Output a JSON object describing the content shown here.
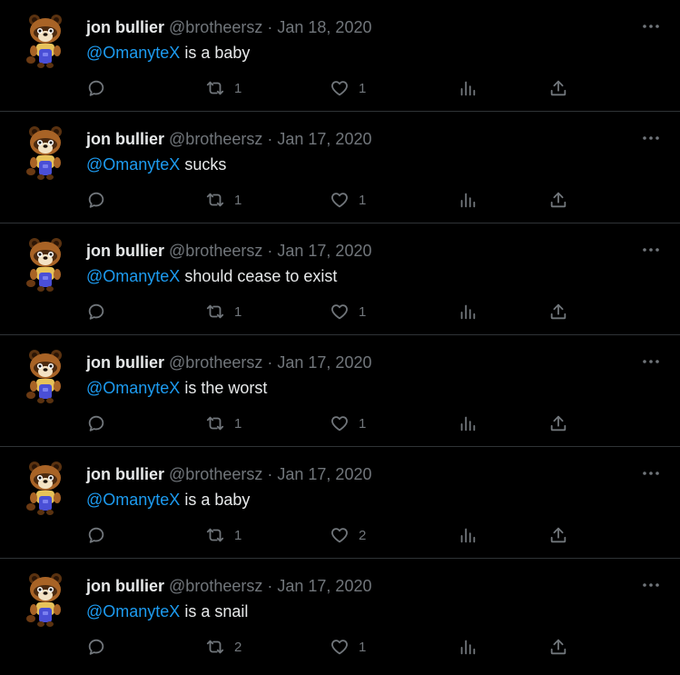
{
  "colors": {
    "background": "#000000",
    "text_primary": "#e7e9ea",
    "text_secondary": "#71767b",
    "mention": "#1d9bf0",
    "divider": "#2f3336"
  },
  "icons": {
    "reply": "reply-icon",
    "retweet": "retweet-icon",
    "like": "heart-icon",
    "views": "views-icon",
    "share": "share-icon",
    "more": "more-icon"
  },
  "tweets": [
    {
      "author_name": "jon bullier",
      "handle": "@brotheersz",
      "separator": "·",
      "date": "Jan 18, 2020",
      "mention": "@OmanyteX",
      "text": " is a baby",
      "retweets": "1",
      "likes": "1"
    },
    {
      "author_name": "jon bullier",
      "handle": "@brotheersz",
      "separator": "·",
      "date": "Jan 17, 2020",
      "mention": "@OmanyteX",
      "text": " sucks",
      "retweets": "1",
      "likes": "1"
    },
    {
      "author_name": "jon bullier",
      "handle": "@brotheersz",
      "separator": "·",
      "date": "Jan 17, 2020",
      "mention": "@OmanyteX",
      "text": " should cease to exist",
      "retweets": "1",
      "likes": "1"
    },
    {
      "author_name": "jon bullier",
      "handle": "@brotheersz",
      "separator": "·",
      "date": "Jan 17, 2020",
      "mention": "@OmanyteX",
      "text": " is the worst",
      "retweets": "1",
      "likes": "1"
    },
    {
      "author_name": "jon bullier",
      "handle": "@brotheersz",
      "separator": "·",
      "date": "Jan 17, 2020",
      "mention": "@OmanyteX",
      "text": " is a baby",
      "retweets": "1",
      "likes": "2"
    },
    {
      "author_name": "jon bullier",
      "handle": "@brotheersz",
      "separator": "·",
      "date": "Jan 17, 2020",
      "mention": "@OmanyteX",
      "text": " is a snail",
      "retweets": "2",
      "likes": "1"
    }
  ]
}
